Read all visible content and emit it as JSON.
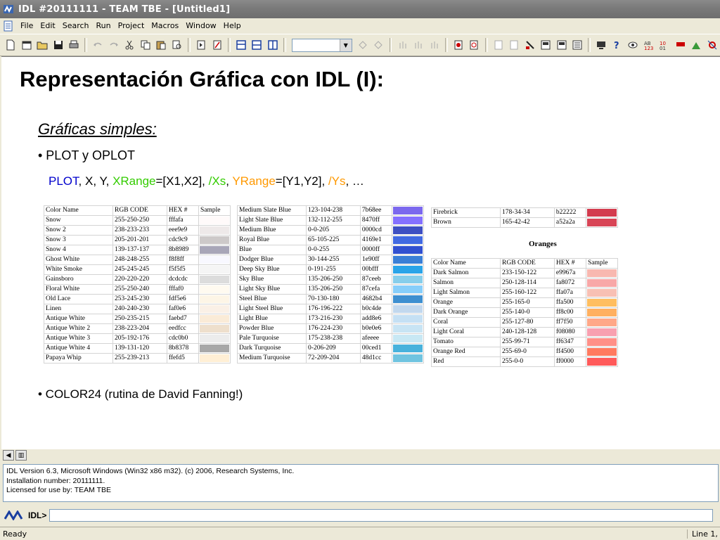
{
  "window": {
    "title": "IDL #20111111 - TEAM TBE - [Untitled1]"
  },
  "menu": [
    "File",
    "Edit",
    "Search",
    "Run",
    "Project",
    "Macros",
    "Window",
    "Help"
  ],
  "toolbar_icons": [
    "new-file-icon",
    "new-project-icon",
    "open-icon",
    "save-icon",
    "print-icon",
    "undo-icon",
    "redo-icon",
    "cut-icon",
    "copy-icon",
    "paste-icon",
    "find-icon",
    "compile-icon",
    "run-icon",
    "layout-a-icon",
    "layout-b-icon",
    "layout-c-icon",
    "step-into-icon",
    "step-over-icon",
    "step-out-icon",
    "step-return-icon",
    "step-end-icon",
    "breakpoint-icon",
    "clear-breakpoint-icon",
    "indent-icon",
    "outdent-icon",
    "comment-icon",
    "uncomment-icon",
    "list-icon",
    "display-icon",
    "help-icon",
    "watch-icon",
    "ab-icon",
    "ten-icon",
    "flag-icon",
    "tools-icon",
    "gear-icon"
  ],
  "slide": {
    "title": "Representación Gráfica con IDL (I):",
    "subtitle": "Gráficas simples:",
    "bullet1": "• PLOT y OPLOT",
    "code": {
      "plot": "PLOT",
      "args": ", X, Y, ",
      "xrange": "XRange",
      "xrange_val": "=[X1,X2], ",
      "xs": "/Xs",
      "sep": ", ",
      "yrange": "YRange",
      "yrange_val": "=[Y1,Y2], ",
      "ys": "/Ys",
      "tail": ", …"
    },
    "bullet2": "• COLOR24 (rutina de David Fanning!)"
  },
  "table1": {
    "headers": [
      "Color Name",
      "RGB CODE",
      "HEX #",
      "Sample"
    ],
    "rows": [
      [
        "Snow",
        "255-250-250",
        "fffafa",
        "#fffafa"
      ],
      [
        "Snow 2",
        "238-233-233",
        "eee9e9",
        "#eee9e9"
      ],
      [
        "Snow 3",
        "205-201-201",
        "cdc9c9",
        "#cdc9c9"
      ],
      [
        "Snow 4",
        "139-137-137",
        "8b8989",
        "#a8a6b8"
      ],
      [
        "Ghost White",
        "248-248-255",
        "f8f8ff",
        "#f8f8ff"
      ],
      [
        "White Smoke",
        "245-245-245",
        "f5f5f5",
        "#f5f5f5"
      ],
      [
        "Gainsboro",
        "220-220-220",
        "dcdcdc",
        "#dcdcdc"
      ],
      [
        "Floral White",
        "255-250-240",
        "fffaf0",
        "#fffaf0"
      ],
      [
        "Old Lace",
        "253-245-230",
        "fdf5e6",
        "#fdf5e6"
      ],
      [
        "Linen",
        "240-240-230",
        "faf0e6",
        "#faf0e6"
      ],
      [
        "Antique White",
        "250-235-215",
        "faebd7",
        "#faebd7"
      ],
      [
        "Antique White 2",
        "238-223-204",
        "eedfcc",
        "#eedfcc"
      ],
      [
        "Antique White 3",
        "205-192-176",
        "cdc0b0",
        "#ececec"
      ],
      [
        "Antique White 4",
        "139-131-120",
        "8b8378",
        "#a8a8a8"
      ],
      [
        "Papaya Whip",
        "255-239-213",
        "ffefd5",
        "#ffefd5"
      ]
    ]
  },
  "table2": {
    "rows": [
      [
        "Medium Slate Blue",
        "123-104-238",
        "7b68ee",
        "#7b68ee"
      ],
      [
        "Light Slate Blue",
        "132-112-255",
        "8470ff",
        "#8470ff"
      ],
      [
        "Medium Blue",
        "0-0-205",
        "0000cd",
        "#3d4fc2"
      ],
      [
        "Royal Blue",
        "65-105-225",
        "4169e1",
        "#4169e1"
      ],
      [
        "Blue",
        "0-0-255",
        "0000ff",
        "#3150d0"
      ],
      [
        "Dodger Blue",
        "30-144-255",
        "1e90ff",
        "#3a7fd6"
      ],
      [
        "Deep Sky Blue",
        "0-191-255",
        "00bfff",
        "#2aa4e8"
      ],
      [
        "Sky Blue",
        "135-206-250",
        "87ceeb",
        "#87ceeb"
      ],
      [
        "Light Sky Blue",
        "135-206-250",
        "87cefa",
        "#87cefa"
      ],
      [
        "Steel Blue",
        "70-130-180",
        "4682b4",
        "#3e8fd0"
      ],
      [
        "Light Steel Blue",
        "176-196-222",
        "b0c4de",
        "#c2d8ee"
      ],
      [
        "Light Blue",
        "173-216-230",
        "add8e6",
        "#c5e0f4"
      ],
      [
        "Powder Blue",
        "176-224-230",
        "b0e0e6",
        "#c8e4f4"
      ],
      [
        "Pale Turquoise",
        "175-238-238",
        "afeeee",
        "#c8e8f4"
      ],
      [
        "Dark Turquoise",
        "0-206-209",
        "00ced1",
        "#48b2dc"
      ],
      [
        "Medium Turquoise",
        "72-209-204",
        "48d1cc",
        "#70c4e0"
      ]
    ]
  },
  "table3": {
    "rows": [
      [
        "Firebrick",
        "178-34-34",
        "b22222",
        "#d33b4e"
      ],
      [
        "Brown",
        "165-42-42",
        "a52a2a",
        "#d84556"
      ]
    ]
  },
  "oranges": {
    "title": "Oranges",
    "headers": [
      "Color Name",
      "RGB CODE",
      "HEX #",
      "Sample"
    ],
    "rows": [
      [
        "Dark Salmon",
        "233-150-122",
        "e9967a",
        "#f8b8b0"
      ],
      [
        "Salmon",
        "250-128-114",
        "fa8072",
        "#f8a8a8"
      ],
      [
        "Light Salmon",
        "255-160-122",
        "ffa07a",
        "#f8c0b4"
      ],
      [
        "Orange",
        "255-165-0",
        "ffa500",
        "#ffbe60"
      ],
      [
        "Dark Orange",
        "255-140-0",
        "ff8c00",
        "#ffb060"
      ],
      [
        "Coral",
        "255-127-80",
        "ff7f50",
        "#ffa888"
      ],
      [
        "Light Coral",
        "240-128-128",
        "f08080",
        "#f8a0b0"
      ],
      [
        "Tomato",
        "255-99-71",
        "ff6347",
        "#ff9088"
      ],
      [
        "Orange Red",
        "255-69-0",
        "ff4500",
        "#ff7a60"
      ],
      [
        "Red",
        "255-0-0",
        "ff0000",
        "#ff5a5a"
      ]
    ]
  },
  "console": {
    "lines": [
      "IDL Version 6.3, Microsoft Windows (Win32 x86 m32). (c) 2006, Research Systems, Inc.",
      "Installation number: 20111111.",
      "Licensed for use by: TEAM TBE"
    ]
  },
  "command": {
    "prompt": "IDL>",
    "value": ""
  },
  "status": {
    "left": "Ready",
    "right": "Line 1, Col 1"
  }
}
